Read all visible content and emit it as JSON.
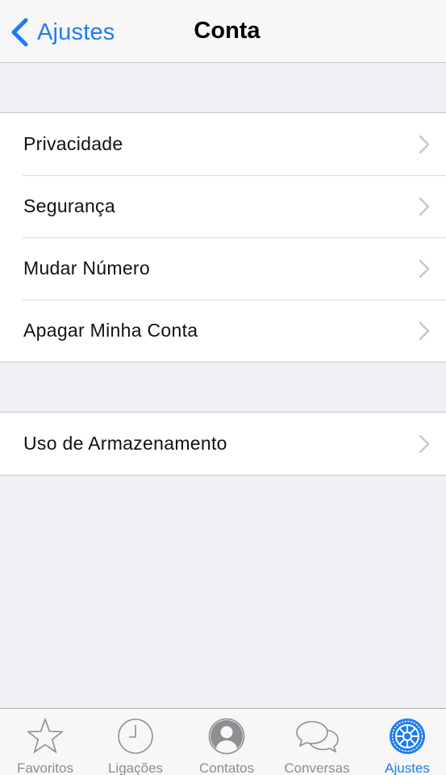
{
  "navbar": {
    "back_label": "Ajustes",
    "title": "Conta"
  },
  "groups": [
    {
      "items": [
        {
          "label": "Privacidade"
        },
        {
          "label": "Segurança"
        },
        {
          "label": "Mudar Número"
        },
        {
          "label": "Apagar Minha Conta"
        }
      ]
    },
    {
      "items": [
        {
          "label": "Uso de Armazenamento"
        }
      ]
    }
  ],
  "tabbar": {
    "tabs": [
      {
        "label": "Favoritos",
        "icon": "star-icon",
        "active": false
      },
      {
        "label": "Ligações",
        "icon": "clock-icon",
        "active": false
      },
      {
        "label": "Contatos",
        "icon": "person-icon",
        "active": false
      },
      {
        "label": "Conversas",
        "icon": "chat-bubbles-icon",
        "active": false
      },
      {
        "label": "Ajustes",
        "icon": "gear-icon",
        "active": true
      }
    ]
  },
  "colors": {
    "accent": "#1e7cf0",
    "inactive": "#8e8e93",
    "background": "#efeff4"
  }
}
